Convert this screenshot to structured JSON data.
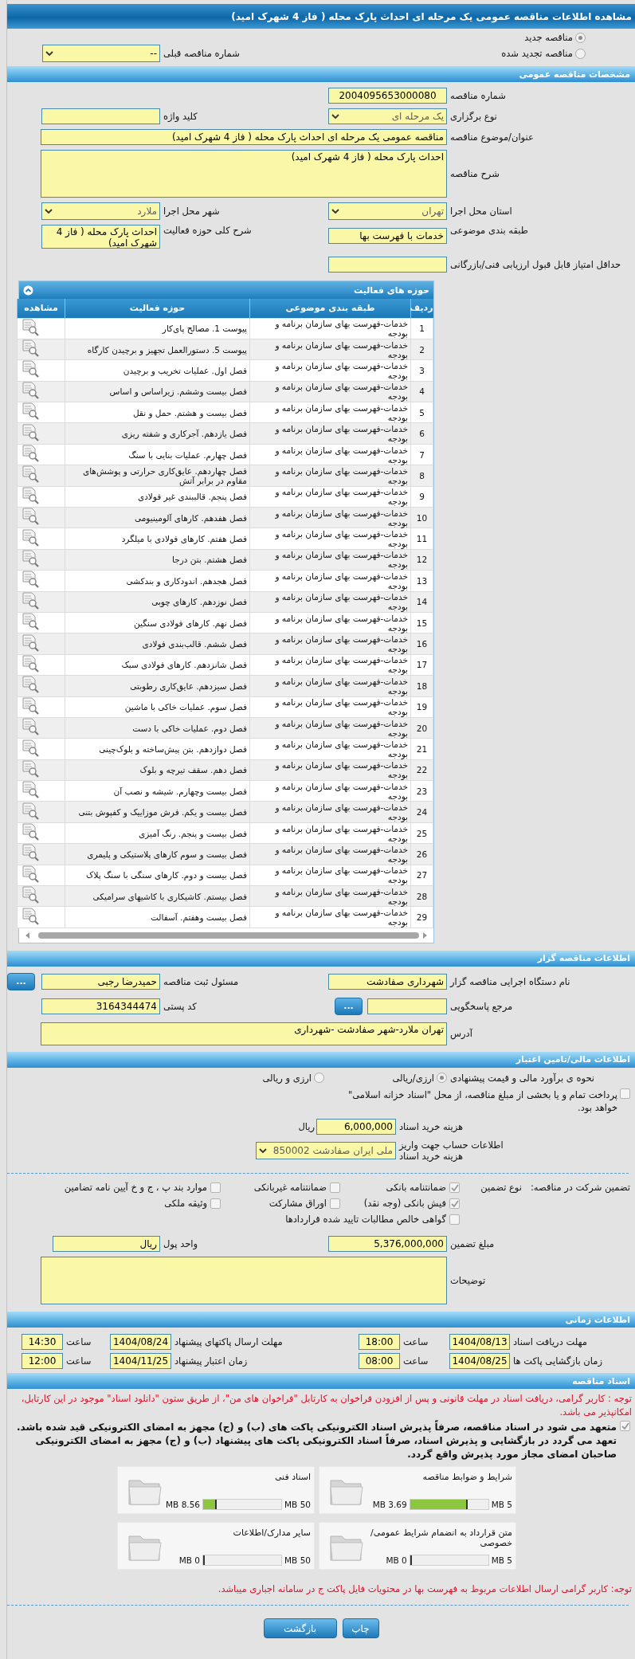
{
  "page_title": "مشاهده اطلاعات مناقصه عمومی یک مرحله ای احداث پارک محله ( فاز 4 شهرک امید)",
  "tender_status": [
    {
      "label": "مناقصه جدید",
      "selected": true
    },
    {
      "label": "مناقصه تجدید شده",
      "selected": false
    }
  ],
  "previous_tender": {
    "label": "شماره مناقصه قبلی",
    "value": "--",
    "disabled": false
  },
  "general": {
    "title": "مشخصات مناقصه عمومی",
    "tender_number": {
      "label": "شماره مناقصه",
      "value": "2004095653000080"
    },
    "holding_type": {
      "label": "نوع برگزاری",
      "value": "یک مرحله ای",
      "disabled": true
    },
    "keyword": {
      "label": "کلید واژه"
    },
    "subject": {
      "label": "عنوان/موضوع مناقصه",
      "value": "مناقصه عمومی یک مرحله ای احداث پارک محله ( فاز 4 شهرک امید)"
    },
    "description": {
      "label": "شرح مناقصه",
      "value": "احداث پارک محله ( فاز 4 شهرک امید)"
    },
    "province": {
      "label": "استان محل اجرا",
      "value": "تهران",
      "disabled": true
    },
    "city": {
      "label": "شهر محل اجرا",
      "value": "ملارد",
      "disabled": true
    },
    "category": {
      "label": "طبقه بندی موضوعی",
      "value": "خدمات با فهرست بها"
    },
    "activity_summary": {
      "label": "شرح کلی حوزه فعالیت",
      "value": "احداث پارک محله ( فاز 4 شهرک امید)"
    },
    "min_score": {
      "label": "حداقل امتیاز قابل قبول ارزیابی فنی/بازرگانی"
    }
  },
  "activity_areas": {
    "title": "حوزه های فعالیت",
    "columns": [
      "ردیف",
      "طبقه بندی موضوعی",
      "حوزه فعالیت",
      "مشاهده"
    ],
    "rows": [
      {
        "index": "1",
        "category": "خدمات-فهرست بهای سازمان برنامه و بودجه",
        "activity": "پیوست 1. مصالح پای‌کار"
      },
      {
        "index": "2",
        "category": "خدمات-فهرست بهای سازمان برنامه و بودجه",
        "activity": "پیوست 5. دستورالعمل تجهیز و برچیدن کارگاه"
      },
      {
        "index": "3",
        "category": "خدمات-فهرست بهای سازمان برنامه و بودجه",
        "activity": "فصل اول. عملیات تخریب و برچیدن"
      },
      {
        "index": "4",
        "category": "خدمات-فهرست بهای سازمان برنامه و بودجه",
        "activity": "فصل بیست وششم. زیراساس و اساس"
      },
      {
        "index": "5",
        "category": "خدمات-فهرست بهای سازمان برنامه و بودجه",
        "activity": "فصل بیست و هشتم. حمل و نقل"
      },
      {
        "index": "6",
        "category": "خدمات-فهرست بهای سازمان برنامه و بودجه",
        "activity": "فصل یازدهم. آجرکاری و شفته ریزی"
      },
      {
        "index": "7",
        "category": "خدمات-فهرست بهای سازمان برنامه و بودجه",
        "activity": "فصل چهارم. عملیات بنایی با سنگ"
      },
      {
        "index": "8",
        "category": "خدمات-فهرست بهای سازمان برنامه و بودجه",
        "activity": "فصل چهاردهم. عایق‌کاری حرارتی و پوشش‌های مقاوم در برابر آتش"
      },
      {
        "index": "9",
        "category": "خدمات-فهرست بهای سازمان برنامه و بودجه",
        "activity": "فصل پنجم. قالببندی غیر فولادی"
      },
      {
        "index": "10",
        "category": "خدمات-فهرست بهای سازمان برنامه و بودجه",
        "activity": "فصل هفدهم. کارهای آلومینیومی"
      },
      {
        "index": "11",
        "category": "خدمات-فهرست بهای سازمان برنامه و بودجه",
        "activity": "فصل هفتم. کارهای فولادی با میلگرد"
      },
      {
        "index": "12",
        "category": "خدمات-فهرست بهای سازمان برنامه و بودجه",
        "activity": "فصل هشتم. بتن درجا"
      },
      {
        "index": "13",
        "category": "خدمات-فهرست بهای سازمان برنامه و بودجه",
        "activity": "فصل هجدهم. اندودکاری و بندکشی"
      },
      {
        "index": "14",
        "category": "خدمات-فهرست بهای سازمان برنامه و بودجه",
        "activity": "فصل نوزدهم. کارهای چوبی"
      },
      {
        "index": "15",
        "category": "خدمات-فهرست بهای سازمان برنامه و بودجه",
        "activity": "فصل نهم. کارهای فولادی سنگین"
      },
      {
        "index": "16",
        "category": "خدمات-فهرست بهای سازمان برنامه و بودجه",
        "activity": "فصل ششم. قالب‌بندی فولادی"
      },
      {
        "index": "17",
        "category": "خدمات-فهرست بهای سازمان برنامه و بودجه",
        "activity": "فصل شانزدهم. کارهای فولادی سبک"
      },
      {
        "index": "18",
        "category": "خدمات-فهرست بهای سازمان برنامه و بودجه",
        "activity": "فصل سیزدهم. عایق‌کاری رطوبتی"
      },
      {
        "index": "19",
        "category": "خدمات-فهرست بهای سازمان برنامه و بودجه",
        "activity": "فصل سوم. عملیات خاکی با ماشین"
      },
      {
        "index": "20",
        "category": "خدمات-فهرست بهای سازمان برنامه و بودجه",
        "activity": "فصل دوم. عملیات خاکی با دست"
      },
      {
        "index": "21",
        "category": "خدمات-فهرست بهای سازمان برنامه و بودجه",
        "activity": "فصل دوازدهم. بتن پیش‌ساخته و بلوک‌چینی"
      },
      {
        "index": "22",
        "category": "خدمات-فهرست بهای سازمان برنامه و بودجه",
        "activity": "فصل دهم. سقف تیرچه و بلوک"
      },
      {
        "index": "23",
        "category": "خدمات-فهرست بهای سازمان برنامه و بودجه",
        "activity": "فصل بیست وچهارم. شیشه و نصب آن"
      },
      {
        "index": "24",
        "category": "خدمات-فهرست بهای سازمان برنامه و بودجه",
        "activity": "فصل بیست و یکم. فرش موزاییک و کفپوش بتنی"
      },
      {
        "index": "25",
        "category": "خدمات-فهرست بهای سازمان برنامه و بودجه",
        "activity": "فصل بیست و پنجم. رنگ آمیزی"
      },
      {
        "index": "26",
        "category": "خدمات-فهرست بهای سازمان برنامه و بودجه",
        "activity": "فصل بیست و سوم کارهای پلاستیکی و پلیمری"
      },
      {
        "index": "27",
        "category": "خدمات-فهرست بهای سازمان برنامه و بودجه",
        "activity": "فصل بیست و دوم. کارهای سنگی با سنگ پلاک"
      },
      {
        "index": "28",
        "category": "خدمات-فهرست بهای سازمان برنامه و بودجه",
        "activity": "فصل بیستم. کاشیکاری با کاشیهای سرامیکی"
      },
      {
        "index": "29",
        "category": "خدمات-فهرست بهای سازمان برنامه و بودجه",
        "activity": "فصل بیست وهفتم. آسفالت"
      }
    ]
  },
  "organizer": {
    "title": "اطلاعات مناقصه گزار",
    "org_name": {
      "label": "نام دستگاه اجرایی مناقصه گزار",
      "value": "شهرداری صفادشت"
    },
    "registrar": {
      "label": "مسئول ثبت مناقصه",
      "value": "حمیدرضا رجبی",
      "button": "..."
    },
    "reference": {
      "label": "مرجع پاسخگویی",
      "button": "..."
    },
    "postal_code": {
      "label": "کد پستی",
      "value": "3164344474"
    },
    "address": {
      "label": "آدرس",
      "value": "تهران ملارد-شهر صفادشت -شهرداری"
    }
  },
  "finance": {
    "title": "اطلاعات مالی/تامین اعتبار",
    "estimate": {
      "label": "نحوه ی برآورد مالی و قیمت پیشنهادی",
      "options": [
        {
          "label": "ارزی/ریالی",
          "selected": true
        },
        {
          "label": "ارزی و ریالی",
          "selected": false
        }
      ]
    },
    "treasury": {
      "text": "پرداخت تمام و یا بخشی از مبلغ مناقصه، از محل \"اسناد خزانه اسلامی\" خواهد بود.",
      "checked": false
    },
    "document_fee": {
      "label": "هزینه خرید اسناد",
      "value": "6,000,000",
      "unit": "ریال"
    },
    "account": {
      "label": "اطلاعات حساب جهت واریز هزینه خرید اسناد",
      "value": "ملی ایران صفادشت 850002",
      "disabled": true
    }
  },
  "guarantee": {
    "label": "تضمین شرکت در مناقصه:",
    "type_label": "نوع تضمین",
    "options": [
      {
        "label": "ضمانتنامه بانکی",
        "checked": true
      },
      {
        "label": "ضمانتنامه غیربانکی",
        "checked": false
      },
      {
        "label": "موارد بند پ ، ج و خ آیین نامه تضامین",
        "checked": false
      },
      {
        "label": "فیش بانکی (وجه نقد)",
        "checked": true
      },
      {
        "label": "اوراق مشارکت",
        "checked": false
      },
      {
        "label": "وثیقه ملکی",
        "checked": false
      },
      {
        "label": "گواهی خالص مطالبات تایید شده قراردادها",
        "checked": false
      }
    ],
    "amount": {
      "label": "مبلغ تضمین",
      "value": "5,376,000,000"
    },
    "currency": {
      "label": "واحد پول",
      "value": "ریال"
    },
    "notes": {
      "label": "توضیحات"
    }
  },
  "timing": {
    "title": "اطلاعات زمانی",
    "items": [
      {
        "label": "مهلت دریافت اسناد",
        "date": "1404/08/13",
        "time_label": "ساعت",
        "time": "18:00"
      },
      {
        "label": "مهلت ارسال پاکتهای پیشنهاد",
        "date": "1404/08/24",
        "time_label": "ساعت",
        "time": "14:30"
      },
      {
        "label": "زمان بازگشایی پاکت ها",
        "date": "1404/08/25",
        "time_label": "ساعت",
        "time": "08:00"
      },
      {
        "label": "زمان اعتبار پیشنهاد",
        "date": "1404/11/25",
        "time_label": "ساعت",
        "time": "12:00"
      }
    ]
  },
  "documents": {
    "title": "اسناد مناقصه",
    "notice": "توجه : کاربر گرامی، دریافت اسناد در مهلت قانونی و پس از افزودن فراخوان به کارتابل \"فراخوان های من\"، از طریق ستون \"دانلود اسناد\" موجود در این کارتابل، امکانپذیر می باشد.",
    "commitment": {
      "text": "متعهد می شود در اسناد مناقصه، صرفاً پذیرش اسناد الکترونیکی پاکت های (ب) و (ج) مجهز به امضای الکترونیکی قید شده باشد. تعهد می گردد در بازگشایی و پذیرش اسناد، صرفاً اسناد الکترونیکی پاکت های پیشنهاد (ب) و (ج) مجهز به امضای الکترونیکی صاحبان امضای مجاز مورد پذیرش واقع گردد.",
      "checked": true
    },
    "files": [
      {
        "name": "شرایط و ضوابط مناقصه",
        "size": "3.69 MB",
        "limit": "5 MB",
        "level": 0.738
      },
      {
        "name": "اسناد فنی",
        "size": "8.56 MB",
        "limit": "50 MB",
        "level": 0.171
      },
      {
        "name": "متن قرارداد به انضمام شرایط عمومی/خصوصی",
        "size": "0 MB",
        "limit": "5 MB",
        "level": 0
      },
      {
        "name": "سایر مدارک/اطلاعات",
        "size": "0 MB",
        "limit": "50 MB",
        "level": 0
      }
    ],
    "footer_notice": "توجه: کاربر گرامی ارسال اطلاعات مربوط به فهرست بها در محتویات فایل پاکت ج در سامانه اجباری میباشد."
  },
  "buttons": [
    {
      "label": "چاپ"
    },
    {
      "label": "بازگشت"
    }
  ]
}
